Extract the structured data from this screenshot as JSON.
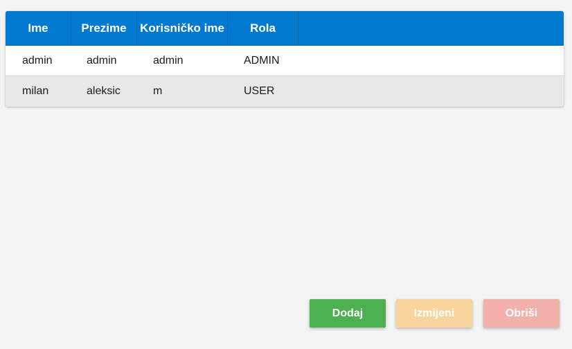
{
  "table": {
    "headers": [
      "Ime",
      "Prezime",
      "Korisničko ime",
      "Rola"
    ],
    "rows": [
      [
        "admin",
        "admin",
        "admin",
        "ADMIN"
      ],
      [
        "milan",
        "aleksic",
        "m",
        "USER"
      ]
    ]
  },
  "actions": {
    "add_label": "Dodaj",
    "edit_label": "Izmijeni",
    "delete_label": "Obriši"
  },
  "colors": {
    "header_bg": "#0179cf",
    "add_button": "#4caf50",
    "edit_button_disabled": "#f9d49b",
    "delete_button_disabled": "#f4b0ab"
  }
}
